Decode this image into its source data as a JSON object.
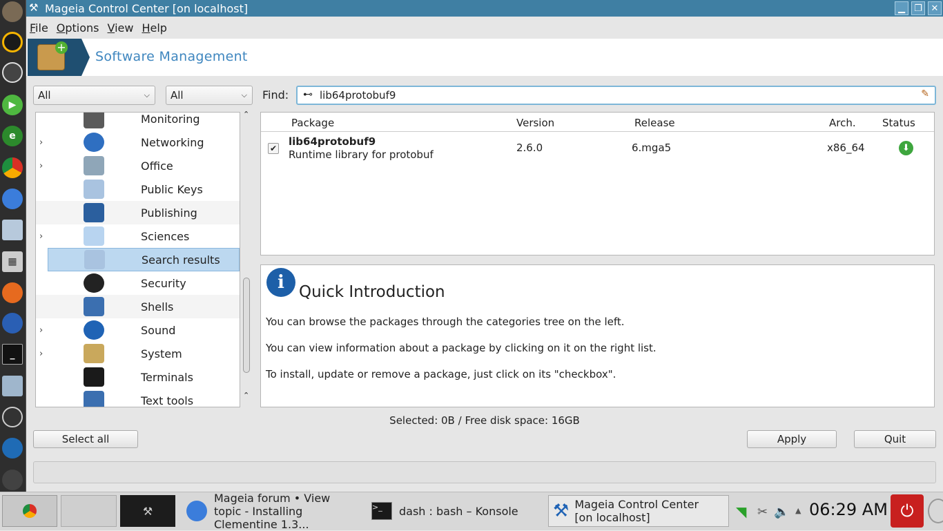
{
  "window": {
    "title": "Mageia Control Center  [on localhost]"
  },
  "menu": [
    "File",
    "Options",
    "View",
    "Help"
  ],
  "banner": {
    "title": "Software Management"
  },
  "filters": {
    "combo1": "All",
    "combo2": "All",
    "find_label": "Find:",
    "find_value": "lib64protobuf9"
  },
  "tree": [
    {
      "label": "Monitoring",
      "expander": ""
    },
    {
      "label": "Networking",
      "expander": "›"
    },
    {
      "label": "Office",
      "expander": "›"
    },
    {
      "label": "Public Keys",
      "expander": ""
    },
    {
      "label": "Publishing",
      "expander": ""
    },
    {
      "label": "Sciences",
      "expander": "›"
    },
    {
      "label": "Search results",
      "expander": "",
      "selected": true
    },
    {
      "label": "Security",
      "expander": ""
    },
    {
      "label": "Shells",
      "expander": ""
    },
    {
      "label": "Sound",
      "expander": "›"
    },
    {
      "label": "System",
      "expander": "›"
    },
    {
      "label": "Terminals",
      "expander": ""
    },
    {
      "label": "Text tools",
      "expander": ""
    }
  ],
  "table": {
    "headers": [
      "Package",
      "Version",
      "Release",
      "Arch.",
      "Status"
    ],
    "rows": [
      {
        "name": "lib64protobuf9",
        "summary": "Runtime library for protobuf",
        "version": "2.6.0",
        "release": "6.mga5",
        "arch": "x86_64",
        "checked": true
      }
    ]
  },
  "info": {
    "title": "Quick Introduction",
    "lines": [
      "You can browse the packages through the categories tree on the left.",
      "You can view information about a package by clicking on it on the right list.",
      "To install, update or remove a package, just click on its \"checkbox\"."
    ]
  },
  "status_text": "Selected: 0B / Free disk space: 16GB",
  "buttons": {
    "select_all": "Select all",
    "apply": "Apply",
    "quit": "Quit"
  },
  "taskbar": {
    "task1": "Mageia forum • View topic - Installing Clementine 1.3...",
    "task2": "dash : bash – Konsole",
    "task3": "Mageia Control Center  [on localhost]",
    "clock": "06:29 AM"
  }
}
